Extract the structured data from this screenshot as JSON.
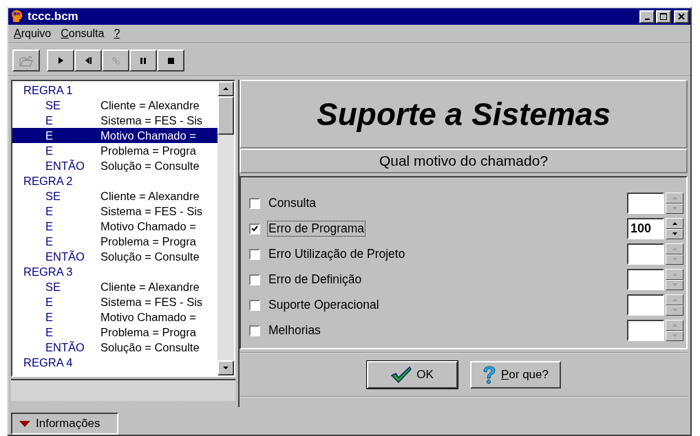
{
  "window": {
    "title": "tccc.bcm"
  },
  "menu": [
    {
      "label": "Arquivo"
    },
    {
      "label": "Consulta"
    },
    {
      "label": "?"
    }
  ],
  "toolbar": [
    {
      "kind": "open",
      "disabled": true
    },
    {
      "kind": "play",
      "disabled": false
    },
    {
      "kind": "step-back",
      "disabled": false
    },
    {
      "kind": "link",
      "disabled": true
    },
    {
      "kind": "pause",
      "disabled": false
    },
    {
      "kind": "stop",
      "disabled": false
    }
  ],
  "rules": [
    {
      "title": "REGRA 1",
      "lines": [
        {
          "keyword": "SE",
          "text": "Cliente = Alexandre",
          "selected": false
        },
        {
          "keyword": "E",
          "text": "Sistema = FES - Sis",
          "selected": false
        },
        {
          "keyword": "E",
          "text": "Motivo Chamado =",
          "selected": true
        },
        {
          "keyword": "E",
          "text": "Problema = Progra",
          "selected": false
        },
        {
          "keyword": "ENTÃO",
          "text": "Solução = Consulte",
          "selected": false
        }
      ]
    },
    {
      "title": "REGRA 2",
      "lines": [
        {
          "keyword": "SE",
          "text": "Cliente = Alexandre",
          "selected": false
        },
        {
          "keyword": "E",
          "text": "Sistema = FES - Sis",
          "selected": false
        },
        {
          "keyword": "E",
          "text": "Motivo Chamado =",
          "selected": false
        },
        {
          "keyword": "E",
          "text": "Problema = Progra",
          "selected": false
        },
        {
          "keyword": "ENTÃO",
          "text": "Solução = Consulte",
          "selected": false
        }
      ]
    },
    {
      "title": "REGRA 3",
      "lines": [
        {
          "keyword": "SE",
          "text": "Cliente = Alexandre",
          "selected": false
        },
        {
          "keyword": "E",
          "text": "Sistema = FES - Sis",
          "selected": false
        },
        {
          "keyword": "E",
          "text": "Motivo Chamado =",
          "selected": false
        },
        {
          "keyword": "E",
          "text": "Problema = Progra",
          "selected": false
        },
        {
          "keyword": "ENTÃO",
          "text": "Solução = Consulte",
          "selected": false
        }
      ]
    },
    {
      "title": "REGRA 4"
    }
  ],
  "panel": {
    "title": "Suporte a Sistemas",
    "question": "Qual motivo do chamado?"
  },
  "options": [
    {
      "label": "Consulta",
      "checked": false,
      "focused": false
    },
    {
      "label": "Erro de Programa",
      "checked": true,
      "focused": true,
      "value": "100"
    },
    {
      "label": "Erro Utilização de Projeto",
      "checked": false,
      "focused": false
    },
    {
      "label": "Erro de Definição",
      "checked": false,
      "focused": false
    },
    {
      "label": "Suporte Operacional",
      "checked": false,
      "focused": false
    },
    {
      "label": "Melhorias",
      "checked": false,
      "focused": false
    }
  ],
  "buttons": [
    {
      "kind": "ok",
      "label": "OK",
      "mnemonic": false,
      "default": true
    },
    {
      "kind": "why",
      "label": "Por que?",
      "mnemonic": true,
      "default": false
    }
  ],
  "bottom_tab": {
    "label": "Informações"
  }
}
